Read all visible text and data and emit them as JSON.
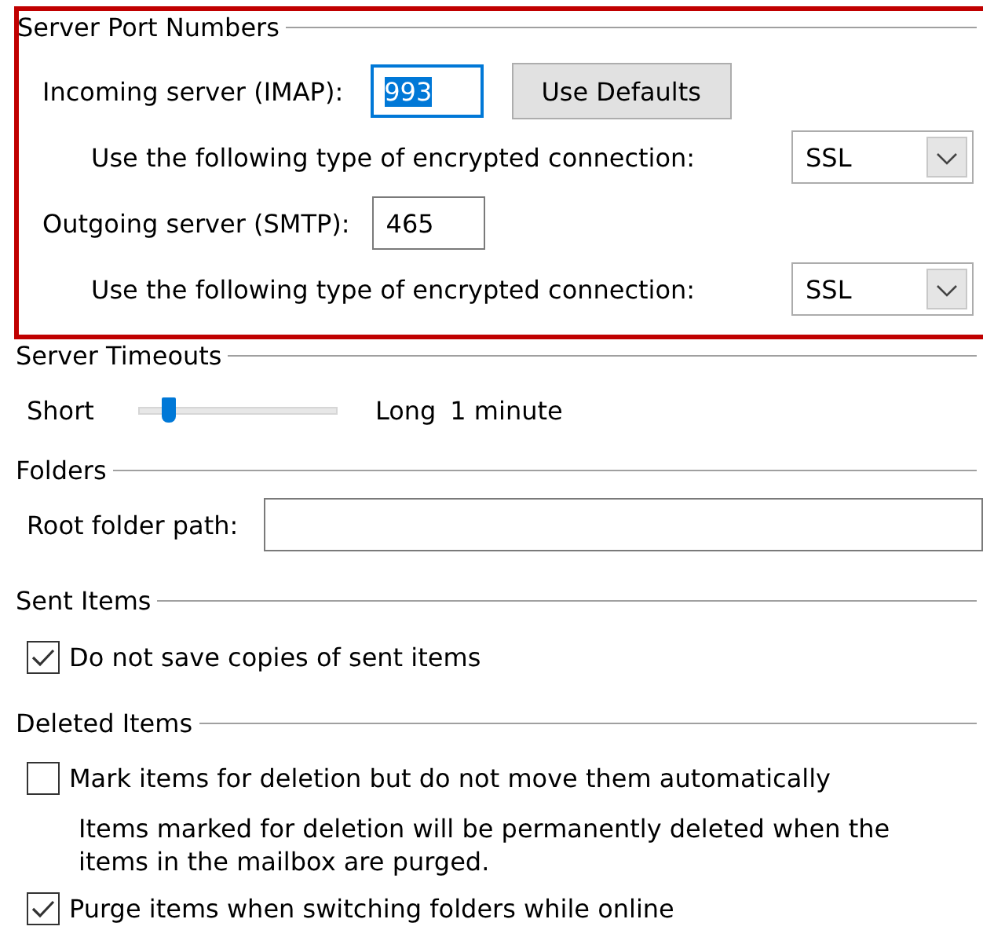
{
  "server_ports": {
    "title": "Server Port Numbers",
    "highlighted": true,
    "incoming": {
      "label": "Incoming server (IMAP):",
      "value": "993",
      "focused": true,
      "text_selected": true,
      "button": "Use Defaults"
    },
    "incoming_encryption": {
      "label": "Use the following type of encrypted connection:",
      "value": "SSL"
    },
    "outgoing": {
      "label": "Outgoing server (SMTP):",
      "value": "465",
      "focused": false,
      "text_selected": false
    },
    "outgoing_encryption": {
      "label": "Use the following type of encrypted connection:",
      "value": "SSL"
    }
  },
  "server_timeouts": {
    "title": "Server Timeouts",
    "min_label": "Short",
    "max_label": "Long",
    "level": 0.12,
    "reading": "1 minute"
  },
  "folders": {
    "title": "Folders",
    "root_folder": {
      "label": "Root folder path:"
    }
  },
  "sent_items": {
    "title": "Sent Items",
    "options": [
      {
        "label": "Do not save copies of sent items",
        "checked": true
      }
    ]
  },
  "deleted_items": {
    "title": "Deleted Items",
    "options": [
      {
        "label": "Mark items for deletion but do not move them automatically",
        "checked": false,
        "note": "Items marked for deletion will be permanently deleted when the items in the mailbox are purged."
      },
      {
        "label": "Purge items when switching folders while online",
        "checked": true
      }
    ]
  }
}
